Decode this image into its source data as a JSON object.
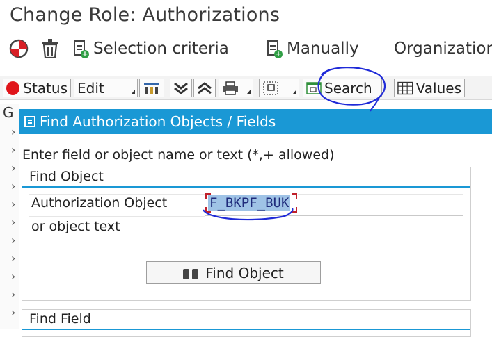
{
  "window": {
    "title": "Change Role: Authorizations"
  },
  "app_toolbar": {
    "selection_criteria": "Selection criteria",
    "manually": "Manually",
    "organization": "Organization"
  },
  "button_bar": {
    "status": "Status",
    "edit": "Edit",
    "search": "Search",
    "values": "Values"
  },
  "tree": {
    "column_head": "G"
  },
  "dialog": {
    "title": "Find Authorization Objects / Fields",
    "instruction": "Enter field or object name or text (*,+ allowed)",
    "find_object": {
      "heading": "Find Object",
      "auth_object_label": "Authorization Object",
      "auth_object_value": "F_BKPF_BUK",
      "object_text_label": "or object text",
      "object_text_value": "",
      "button_label": "Find Object"
    },
    "find_field": {
      "heading": "Find Field"
    }
  },
  "colors": {
    "accent": "#1a98d5",
    "annotation": "#1f2ad8",
    "status_red": "#e0151a"
  }
}
